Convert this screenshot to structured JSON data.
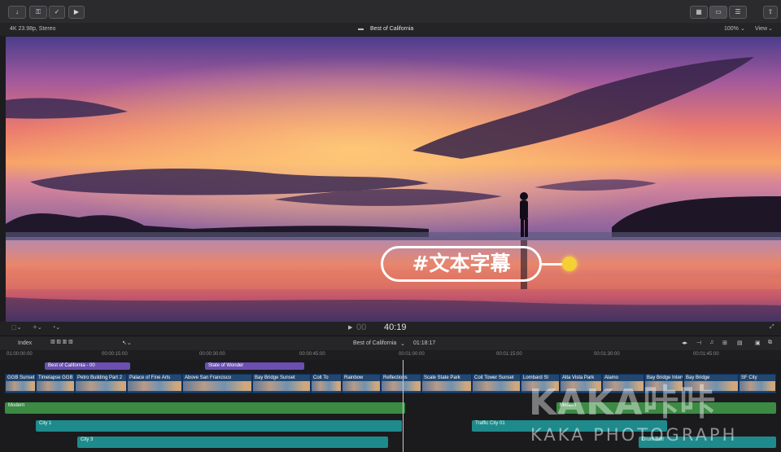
{
  "viewer_header": {
    "format": "4K 23.98p, Stereo",
    "project_title": "Best of California",
    "zoom": "100%",
    "view_menu": "View"
  },
  "toolbar": {
    "left_buttons": [
      "import",
      "keyword",
      "check",
      "share"
    ],
    "right_buttons": [
      "browser-toggle",
      "timeline-toggle",
      "inspector-toggle",
      "share-export"
    ]
  },
  "overlay": {
    "subtitle_text": "#文本字幕"
  },
  "transport": {
    "timecode": "40:19"
  },
  "timeline_header": {
    "index_label": "Index",
    "project_menu": "Best of California",
    "duration": "01:18:17"
  },
  "ruler": {
    "ticks": [
      "01:00:00:00",
      "00:00:15:00",
      "00:00:30:00",
      "00:00:45:00",
      "00:01:00:00",
      "00:01:15:00",
      "00:01:30:00",
      "00:01:45:00"
    ]
  },
  "titles": [
    {
      "label": "Best of California - 00"
    },
    {
      "label": "State of Wonder"
    }
  ],
  "clips": [
    "GGB Sunset",
    "Timelapse GGB",
    "Petro Building Part 2",
    "Palace of Fine Arts",
    "Above San Francisco",
    "Bay Bridge Sunset",
    "Coit To",
    "Rainbow",
    "Reflections",
    "Scale State Park",
    "Coit Tower Sunset",
    "Lombard St",
    "Alta Vista Park",
    "Alamo",
    "Bay Bridge Interval",
    "Bay Bridge",
    "SF City"
  ],
  "audio": {
    "music_left": "Modern",
    "music_right": "Modern",
    "fx1_left": "City 1",
    "fx1_right": "Traffic City 01",
    "fx2_left": "City 3",
    "fx2_right": "Drum Roll"
  },
  "watermark": {
    "main": "KAKA咔咔",
    "sub": "KAKA  PHOTOGRAPH"
  }
}
